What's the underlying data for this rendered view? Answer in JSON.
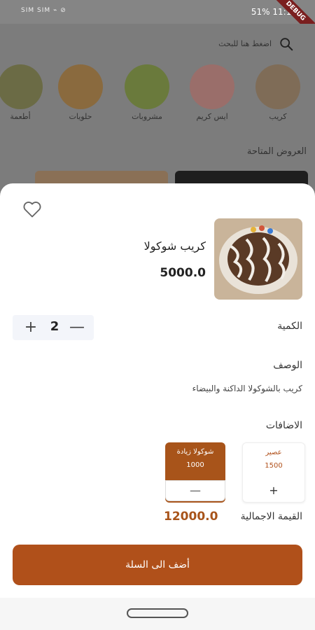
{
  "status_bar": {
    "left": "SIM SIM ⌁ ⊘",
    "battery": "51%",
    "time": "11:11",
    "debug": "DEBUG"
  },
  "background": {
    "search_placeholder": "اضغط هنا للبحث",
    "categories": [
      {
        "label": "أطعمة",
        "color": "#6b6b45"
      },
      {
        "label": "حلويات",
        "color": "#8a6a3e"
      },
      {
        "label": "مشروبات",
        "color": "#6a7a3c"
      },
      {
        "label": "ايس كريم",
        "color": "#9a6e6a"
      },
      {
        "label": "كريب",
        "color": "#7f6c57"
      }
    ],
    "offers_title": "العروض المتاحة"
  },
  "product": {
    "name": "كريب شوكولا",
    "price": "5000.0"
  },
  "quantity": {
    "label": "الكمية",
    "value": "2",
    "plus": "+",
    "minus": "—"
  },
  "description": {
    "label": "الوصف",
    "text": "كريب بالشوكولا الداكنة والبيضاء"
  },
  "addons": {
    "label": "الاضافات",
    "items": [
      {
        "name": "شوكولا زيادة",
        "price": "1000",
        "action": "—"
      },
      {
        "name": "عصير",
        "price": "1500",
        "action": "+"
      }
    ]
  },
  "total": {
    "label": "القيمة الاجمالية",
    "value": "12000.0"
  },
  "add_to_cart": "أضف الى السلة",
  "colors": {
    "accent": "#b0501a",
    "total": "#a8541a"
  }
}
